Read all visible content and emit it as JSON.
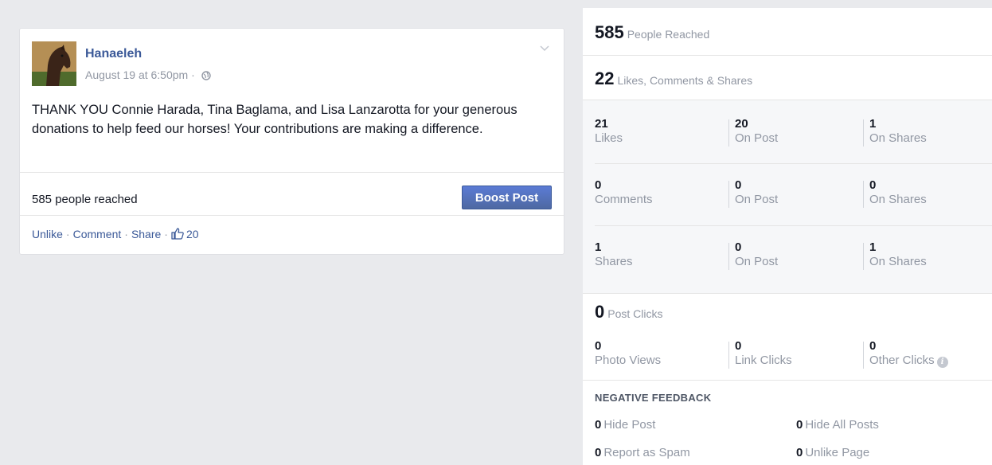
{
  "post": {
    "author": "Hanaeleh",
    "timestamp": "August 19 at 6:50pm · ",
    "privacy_icon": "globe-icon",
    "body": "THANK YOU Connie Harada, Tina Baglama, and Lisa Lanzarotta for your generous donations to help feed our horses! Your contributions are making a difference.",
    "reach_text": "585 people reached",
    "boost_label": "Boost Post",
    "actions": {
      "unlike": "Unlike",
      "comment": "Comment",
      "share": "Share",
      "sep": "·",
      "like_count": "20"
    }
  },
  "insights": {
    "reach": {
      "value": "585",
      "label": "People Reached"
    },
    "engagement": {
      "value": "22",
      "label": "Likes, Comments & Shares"
    },
    "likes": {
      "total": {
        "value": "21",
        "label": "Likes"
      },
      "on_post": {
        "value": "20",
        "label": "On Post"
      },
      "on_shares": {
        "value": "1",
        "label": "On Shares"
      }
    },
    "comments": {
      "total": {
        "value": "0",
        "label": "Comments"
      },
      "on_post": {
        "value": "0",
        "label": "On Post"
      },
      "on_shares": {
        "value": "0",
        "label": "On Shares"
      }
    },
    "shares": {
      "total": {
        "value": "1",
        "label": "Shares"
      },
      "on_post": {
        "value": "0",
        "label": "On Post"
      },
      "on_shares": {
        "value": "1",
        "label": "On Shares"
      }
    },
    "post_clicks": {
      "value": "0",
      "label": "Post Clicks"
    },
    "clicks": {
      "photo_views": {
        "value": "0",
        "label": "Photo Views"
      },
      "link_clicks": {
        "value": "0",
        "label": "Link Clicks"
      },
      "other_clicks": {
        "value": "0",
        "label": "Other Clicks"
      }
    },
    "negative_feedback": {
      "title": "NEGATIVE FEEDBACK",
      "hide_post": {
        "value": "0",
        "label": "Hide Post"
      },
      "hide_all_posts": {
        "value": "0",
        "label": "Hide All Posts"
      },
      "report_spam": {
        "value": "0",
        "label": "Report as Spam"
      },
      "unlike_page": {
        "value": "0",
        "label": "Unlike Page"
      }
    }
  },
  "colors": {
    "link_blue": "#3b5998",
    "muted_gray": "#9197a3",
    "page_bg": "#e9eaed",
    "boost_blue": "#4267b2"
  }
}
